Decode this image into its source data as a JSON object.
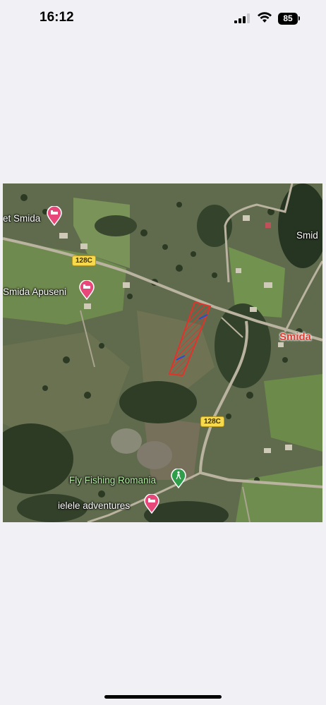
{
  "status_bar": {
    "time": "16:12",
    "battery_level": "85",
    "icons": [
      "cellular-signal-icon",
      "wifi-icon",
      "battery-icon"
    ]
  },
  "map": {
    "labels": {
      "et_smida": "et Smida",
      "smida_apuseni": "Smida Apuseni",
      "smida_top_right": "Smid",
      "smida_village": "Smida",
      "fly_fishing": "Fly Fishing Romania",
      "ielele": "ielele adventures"
    },
    "roads": {
      "upper": "128C",
      "lower": "128C"
    },
    "markers": [
      "lodging-pin-icon",
      "lodging-pin-icon",
      "hiking-pin-icon",
      "lodging-pin-icon"
    ],
    "colors": {
      "parcel": "#e0332b",
      "lodging_pin": "#e8477a",
      "hiking_pin": "#2f9e4a",
      "road_shield": "#f7d94c"
    }
  }
}
